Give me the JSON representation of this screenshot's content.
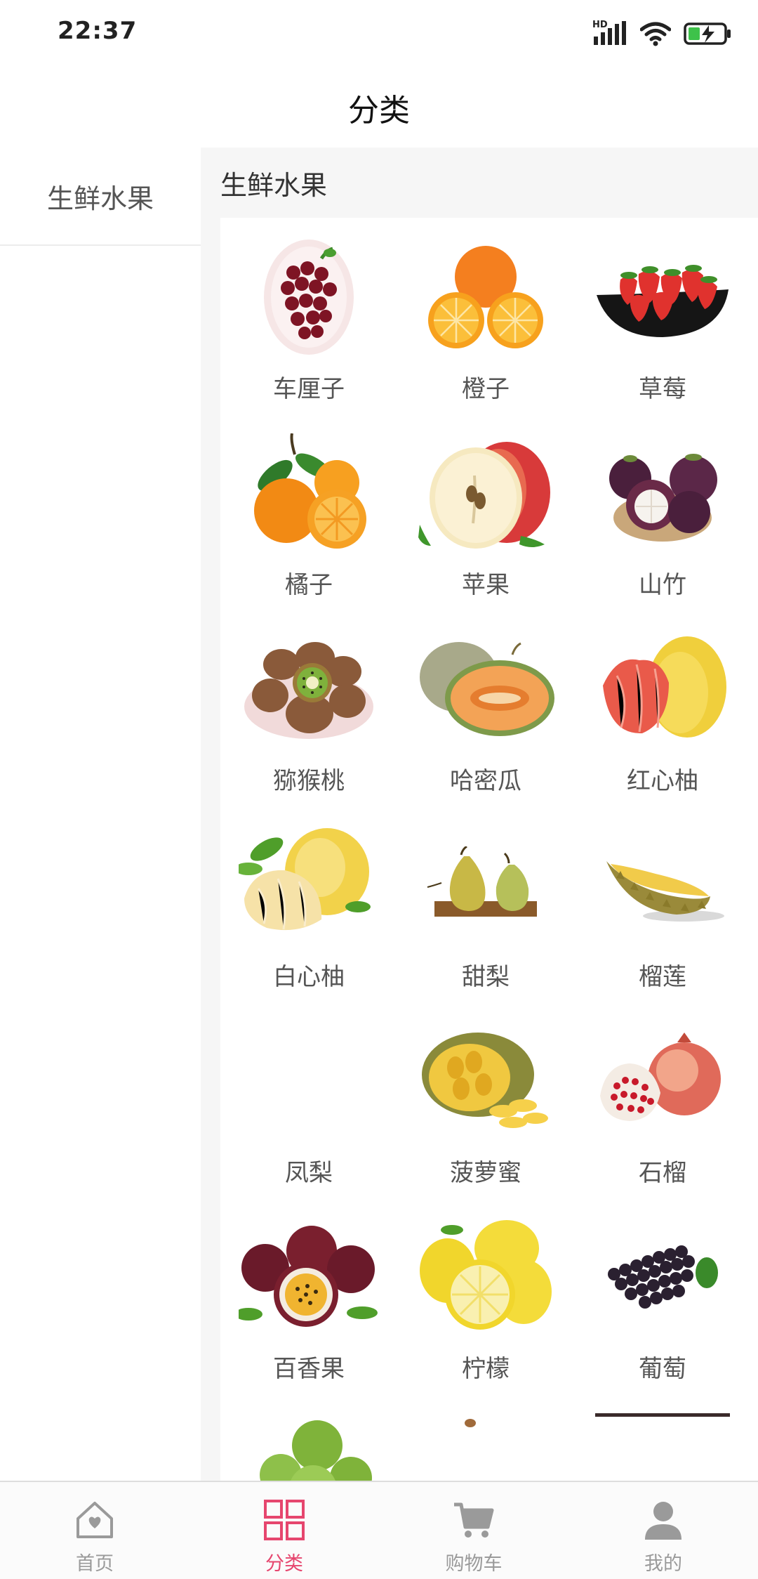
{
  "status_bar": {
    "time": "22:37",
    "network_label": "HD"
  },
  "header": {
    "title": "分类"
  },
  "sidebar": {
    "items": [
      {
        "label": "生鲜水果",
        "selected": true
      }
    ]
  },
  "panel": {
    "title": "生鲜水果",
    "products": [
      {
        "name": "车厘子",
        "icon": "cherry-icon"
      },
      {
        "name": "橙子",
        "icon": "orange-icon"
      },
      {
        "name": "草莓",
        "icon": "strawberry-icon"
      },
      {
        "name": "橘子",
        "icon": "tangerine-icon"
      },
      {
        "name": "苹果",
        "icon": "apple-icon"
      },
      {
        "name": "山竹",
        "icon": "mangosteen-icon"
      },
      {
        "name": "猕猴桃",
        "icon": "kiwi-icon"
      },
      {
        "name": "哈密瓜",
        "icon": "melon-icon"
      },
      {
        "name": "红心柚",
        "icon": "red-pomelo-icon"
      },
      {
        "name": "白心柚",
        "icon": "white-pomelo-icon"
      },
      {
        "name": "甜梨",
        "icon": "pear-icon"
      },
      {
        "name": "榴莲",
        "icon": "durian-icon"
      },
      {
        "name": "凤梨",
        "icon": ""
      },
      {
        "name": "菠萝蜜",
        "icon": "jackfruit-icon"
      },
      {
        "name": "石榴",
        "icon": "pomegranate-icon"
      },
      {
        "name": "百香果",
        "icon": "passion-fruit-icon"
      },
      {
        "name": "柠檬",
        "icon": "lemon-icon"
      },
      {
        "name": "葡萄",
        "icon": "grape-icon"
      },
      {
        "name": "",
        "icon": "green-fruit-icon"
      },
      {
        "name": "",
        "icon": ""
      },
      {
        "name": "",
        "icon": ""
      }
    ]
  },
  "tabbar": {
    "tabs": [
      {
        "label": "首页",
        "icon": "home-icon",
        "active": false
      },
      {
        "label": "分类",
        "icon": "category-grid-icon",
        "active": true
      },
      {
        "label": "购物车",
        "icon": "cart-icon",
        "active": false
      },
      {
        "label": "我的",
        "icon": "user-icon",
        "active": false
      }
    ]
  },
  "colors": {
    "accent": "#e6466e",
    "inactive": "#9a9a9a",
    "panel_bg": "#f6f6f6"
  }
}
